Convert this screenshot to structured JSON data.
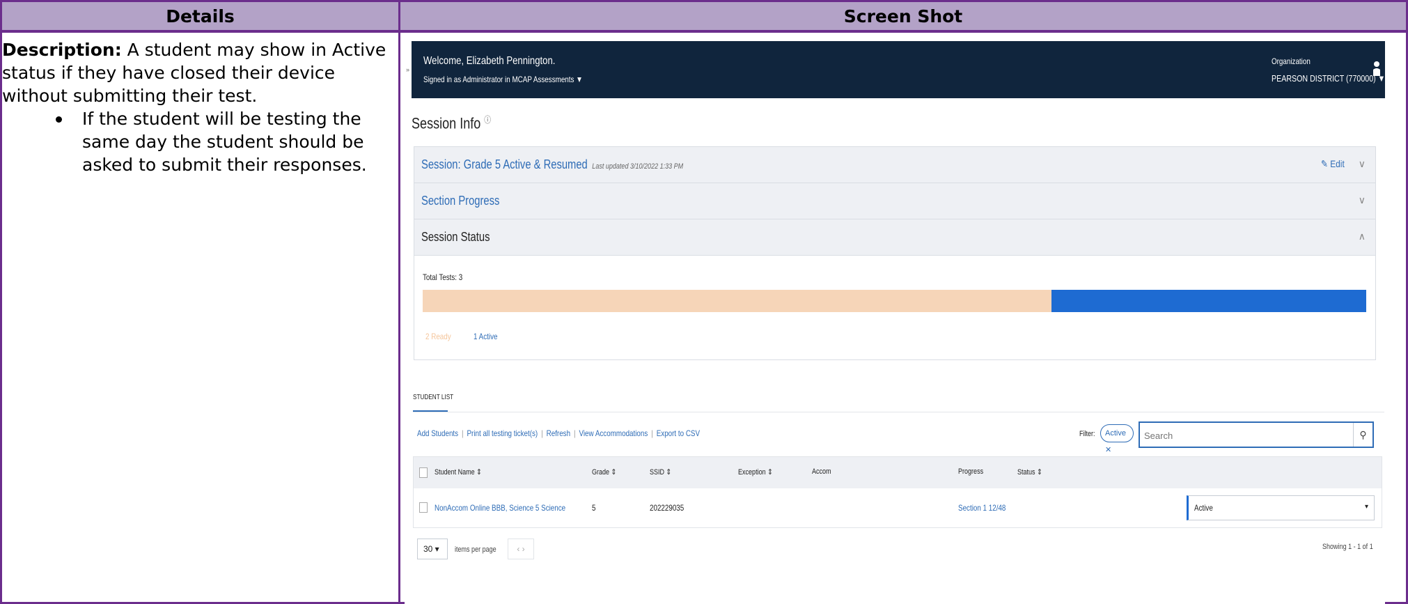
{
  "table": {
    "header_details": "Details",
    "header_screenshot": "Screen Shot"
  },
  "details": {
    "description_label": "Description:",
    "description_text": " A student may show in Active status if they have closed their device without submitting their test.",
    "bullets": [
      "If the student will be testing the same day the student should be asked to submit their responses."
    ]
  },
  "app": {
    "welcome": "Welcome, Elizabeth Pennington.",
    "signed_in_prefix": "Signed in as Administrator in",
    "signed_in_app": "MCAP Assessments ▼",
    "organization_label": "Organization",
    "organization_name": "PEARSON DISTRICT (770000) ▼",
    "page_title": "Session Info",
    "info_icon": "ⓘ",
    "session_title": "Session: Grade 5 Active & Resumed",
    "last_updated": "Last updated 3/10/2022 1:33 PM",
    "edit_label": "✎ Edit",
    "section_progress": "Section Progress",
    "session_status": "Session Status",
    "chev_down": "∨",
    "chev_up": "∧",
    "total_tests": "Total Tests: 3",
    "legend_ready": "2 Ready",
    "legend_active": "1 Active",
    "status_counts": {
      "ready": 2,
      "active": 1
    },
    "colors": {
      "ready": "#f6d5b8",
      "active": "#1e6bd2",
      "navbar": "#10253d",
      "link": "#2e6cb6"
    },
    "student_list_tab": "STUDENT LIST",
    "actions": {
      "add_students": "Add Students",
      "print_tickets": "Print all testing ticket(s)",
      "refresh": "Refresh",
      "view_accommodations": "View Accommodations",
      "export_csv": "Export to CSV",
      "separator": "|"
    },
    "filter_label": "Filter:",
    "filter_chip": "Active ✕",
    "search_placeholder": "Search",
    "search_icon": "⚲",
    "columns": {
      "student_name": "Student Name ⇕",
      "grade": "Grade ⇕",
      "ssid": "SSID ⇕",
      "exception": "Exception ⇕",
      "accom": "Accom",
      "progress": "Progress",
      "status": "Status ⇕"
    },
    "rows": [
      {
        "student_name": "NonAccom Online BBB, Science 5 Science",
        "grade": "5",
        "ssid": "202229035",
        "exception": "",
        "accom": "",
        "progress": "Section 1 12/48",
        "status": "Active",
        "caret": "▾"
      }
    ],
    "per_page_value": "30 ▾",
    "per_page_label": "items per page",
    "pager": "‹  ›",
    "showing": "Showing 1 - 1 of 1"
  }
}
